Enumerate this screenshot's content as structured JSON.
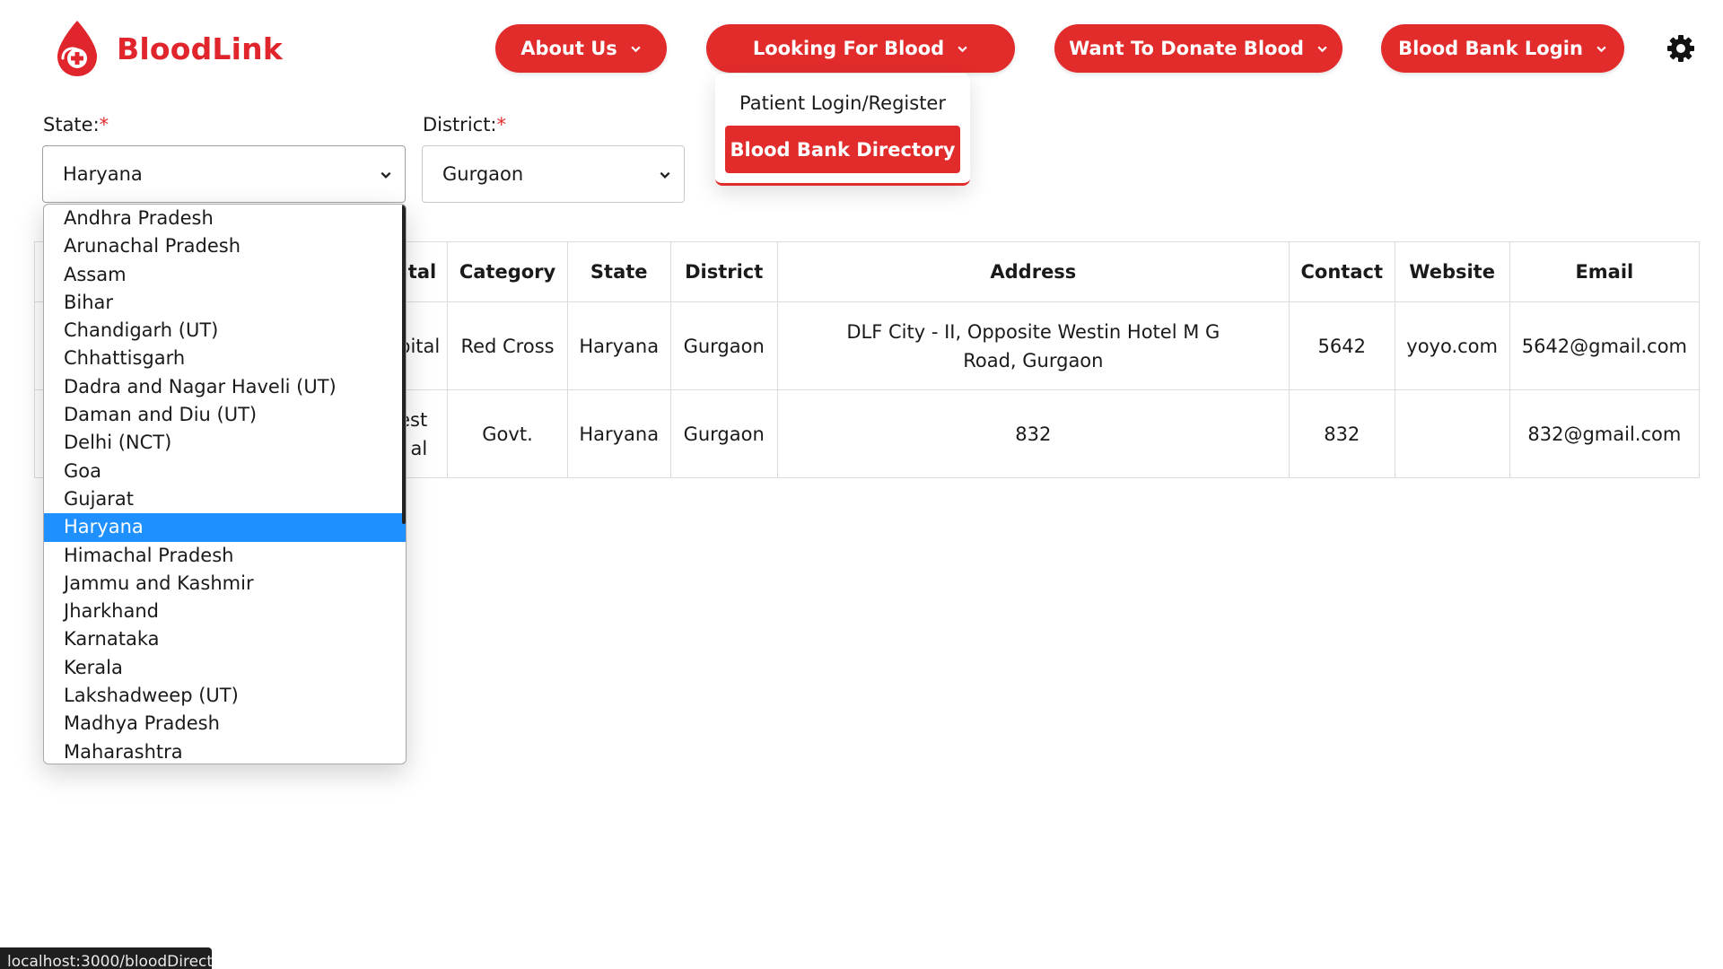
{
  "brand": {
    "name": "BloodLink",
    "color": "#e0262c"
  },
  "nav": {
    "about": "About Us",
    "looking": "Looking For Blood",
    "donate": "Want To Donate Blood",
    "bank_login": "Blood Bank Login",
    "settings_icon": "gear-icon"
  },
  "nav_menu": {
    "items": [
      "Patient Login/Register",
      "Blood Bank Directory"
    ],
    "active": "Blood Bank Directory"
  },
  "form": {
    "state_label": "State:",
    "district_label": "District:",
    "required_mark": "*",
    "state_value": "Haryana",
    "district_value": "Gurgaon"
  },
  "state_options": [
    "Andhra Pradesh",
    "Arunachal Pradesh",
    "Assam",
    "Bihar",
    "Chandigarh (UT)",
    "Chhattisgarh",
    "Dadra and Nagar Haveli (UT)",
    "Daman and Diu (UT)",
    "Delhi (NCT)",
    "Goa",
    "Gujarat",
    "Haryana",
    "Himachal Pradesh",
    "Jammu and Kashmir",
    "Jharkhand",
    "Karnataka",
    "Kerala",
    "Lakshadweep (UT)",
    "Madhya Pradesh",
    "Maharashtra"
  ],
  "selected_state": "Haryana",
  "table": {
    "headers": [
      "spital",
      "Category",
      "State",
      "District",
      "Address",
      "Contact",
      "Website",
      "Email"
    ],
    "rows": [
      {
        "hospital": "pital",
        "category": "Red Cross",
        "state": "Haryana",
        "district": "Gurgaon",
        "address": "DLF City - II, Opposite Westin Hotel M G Road, Gurgaon",
        "contact": "5642",
        "website": "yoyo.com",
        "email": "5642@gmail.com"
      },
      {
        "hospital": "est al",
        "category": "Govt.",
        "state": "Haryana",
        "district": "Gurgaon",
        "address": "832",
        "contact": "832",
        "website": "",
        "email": "832@gmail.com"
      }
    ]
  },
  "status_url": "localhost:3000/bloodDirect",
  "colors": {
    "accent": "#e22b2b",
    "selection": "#1e90ff"
  }
}
